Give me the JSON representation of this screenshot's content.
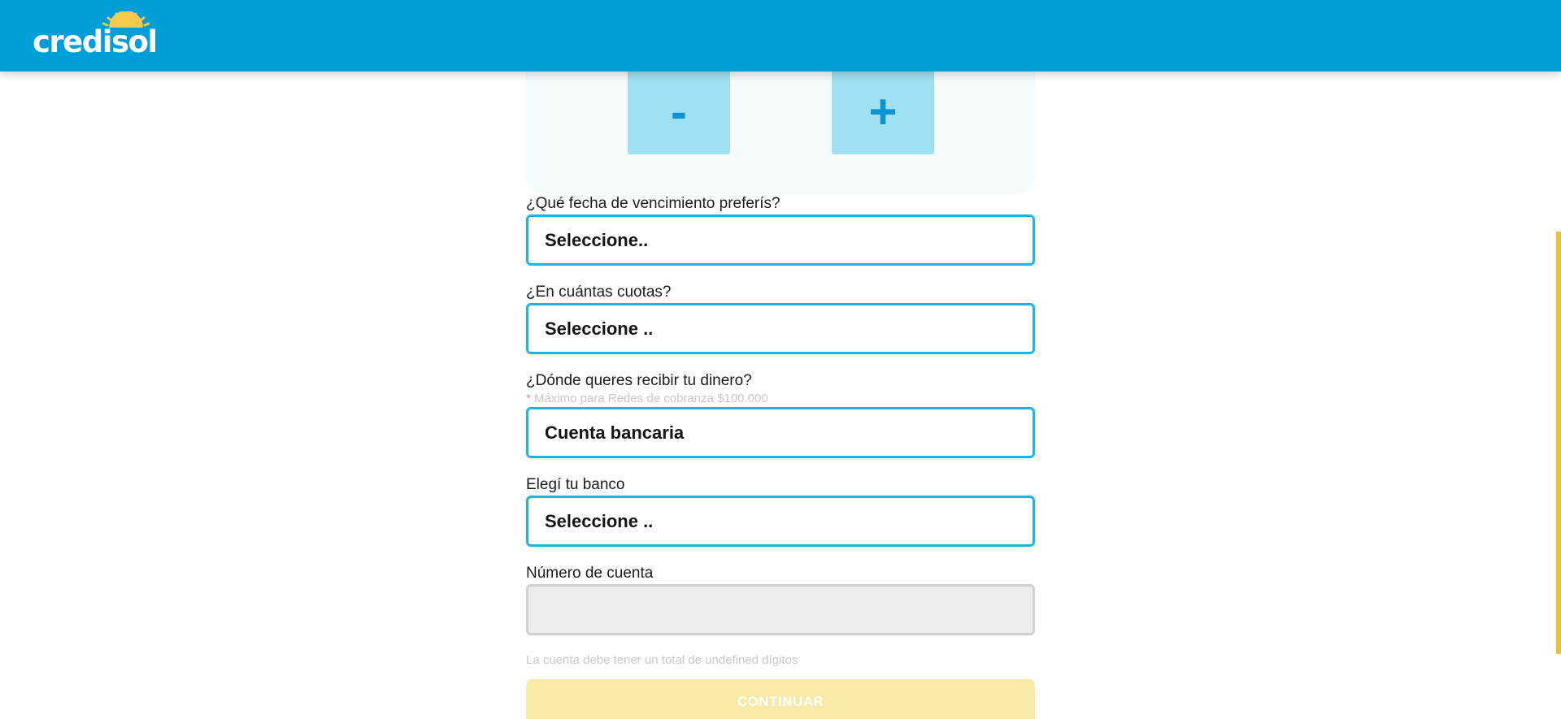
{
  "header": {
    "logo_text": "credisol",
    "background_color": "#009ddb"
  },
  "amount_card": {
    "minus_label": "-",
    "plus_label": "+"
  },
  "form": {
    "due_date": {
      "label": "¿Qué fecha de vencimiento preferís?",
      "value": "Seleccione.."
    },
    "installments": {
      "label": "¿En cuántas cuotas?",
      "value": "Seleccione .."
    },
    "receive_method": {
      "label": "¿Dónde queres recibir tu dinero?",
      "hint_asterisk": "*",
      "hint": " Máximo para Redes de cobranza $100.000",
      "value": "Cuenta bancaria"
    },
    "bank": {
      "label": "Elegí tu banco",
      "value": "Seleccione .."
    },
    "account_number": {
      "label": "Número de cuenta",
      "value": ""
    },
    "account_note": "La cuenta debe tener un total de undefined dígitos",
    "continue_label": "CONTINUAR"
  },
  "colors": {
    "accent": "#009ddb",
    "input_border": "#19b6e3",
    "continue_disabled": "#f7eaa6",
    "side_accent": "#e8c13a"
  }
}
